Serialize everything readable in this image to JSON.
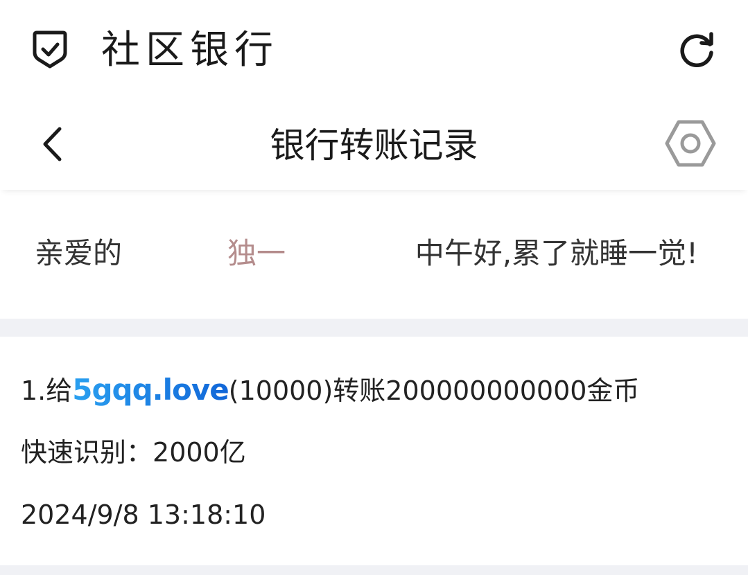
{
  "app": {
    "title": "社区银行"
  },
  "header": {
    "title": "银行转账记录"
  },
  "icons": {
    "app_logo": "shield-check-icon",
    "refresh": "refresh-icon",
    "back": "chevron-left-icon",
    "settings": "hexagon-settings-icon"
  },
  "greeting": {
    "prefix": "亲爱的",
    "name": "独一",
    "message": "中午好,累了就睡一觉!"
  },
  "record": {
    "index_prefix": "1.给",
    "recipient": "5gqq.love",
    "transfer_suffix": "(10000)转账200000000000金币",
    "quick_label": "快速识别：",
    "quick_value": "2000亿",
    "timestamp": "2024/9/8 13:18:10"
  },
  "colors": {
    "accent_name": "#b48c8c",
    "link_start": "#2aa0f0",
    "link_end": "#1166d8",
    "band": "#f0f1f5",
    "text": "#222222"
  }
}
